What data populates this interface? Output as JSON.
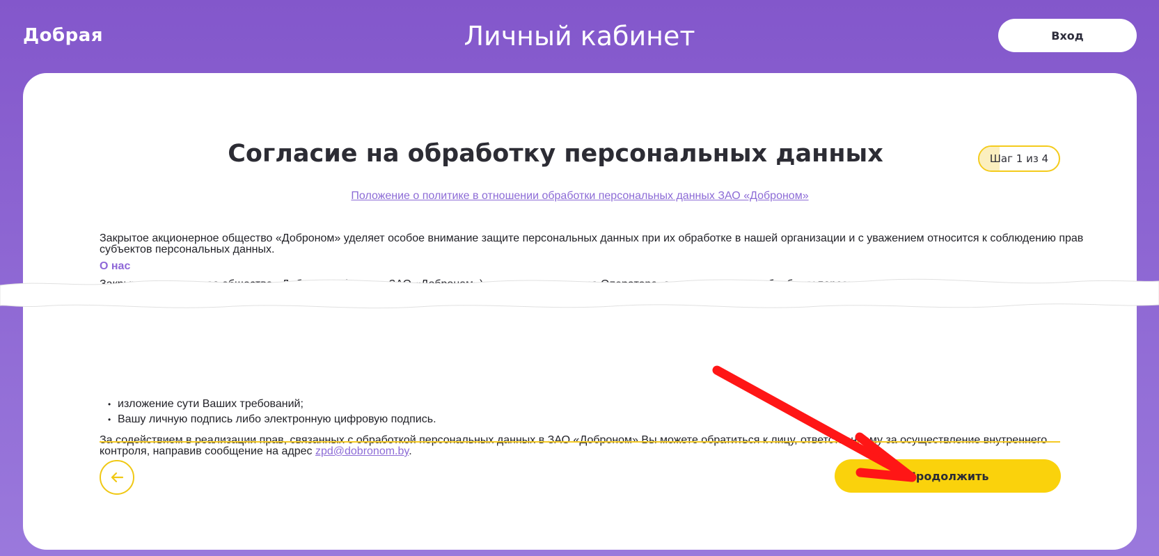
{
  "header": {
    "logo": "Добрая",
    "title": "Личный кабинет",
    "login_label": "Вход"
  },
  "main": {
    "title": "Согласие на обработку персональных данных",
    "step": {
      "label": "Шаг 1 из 4",
      "current": 1,
      "total": 4
    },
    "policy_link": "Положение о политике в отношении обработки персональных данных ЗАО «Доброном»",
    "intro": "Закрытое акционерное общество «Доброном» уделяет особое внимание защите персональных данных при их обработке в нашей организации и с уважением относится к соблюдению прав субъектов персональных данных.",
    "about_heading": "О нас",
    "about_text": "Закрытое акционерное общество «Доброном» (далее - ЗАО «Доброном») выступает в качестве Оператора, осуществляющего обработку персональных данных в",
    "list_items": [
      "изложение сути Ваших требований;",
      "Вашу личную подпись либо электронную цифровую подпись."
    ],
    "contact_text": "За содействием в реализации прав, связанных с обработкой персональных данных в ЗАО «Доброном» Вы можете обратиться к лицу, ответственному за осуществление внутреннего контроля, направив сообщение на адрес",
    "email": "zpd@dobronom.by",
    "continue_label": "Продолжить"
  },
  "colors": {
    "accent_purple": "#8c6bd6",
    "accent_yellow": "#fad20c"
  }
}
